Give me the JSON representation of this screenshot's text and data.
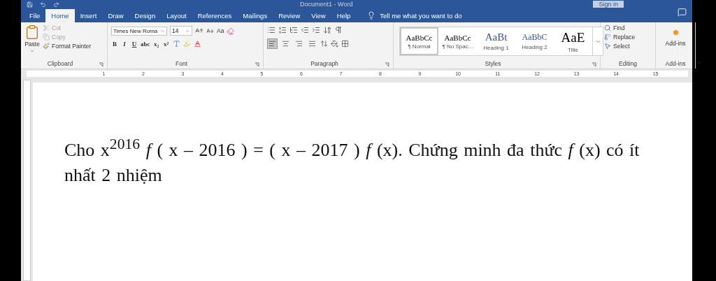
{
  "window": {
    "title": "Document1 - Word",
    "sign_in": "Sign in"
  },
  "tabs": [
    {
      "label": "File",
      "selected": false
    },
    {
      "label": "Home",
      "selected": true
    },
    {
      "label": "Insert",
      "selected": false
    },
    {
      "label": "Draw",
      "selected": false
    },
    {
      "label": "Design",
      "selected": false
    },
    {
      "label": "Layout",
      "selected": false
    },
    {
      "label": "References",
      "selected": false
    },
    {
      "label": "Mailings",
      "selected": false
    },
    {
      "label": "Review",
      "selected": false
    },
    {
      "label": "View",
      "selected": false
    },
    {
      "label": "Help",
      "selected": false
    }
  ],
  "tell_me": "Tell me what you want to do",
  "clipboard": {
    "paste": "Paste",
    "items": [
      {
        "kind": "cut",
        "label": "Cut",
        "disabled": true
      },
      {
        "kind": "copy",
        "label": "Copy",
        "disabled": true
      },
      {
        "kind": "painter",
        "label": "Format Painter",
        "disabled": false
      }
    ],
    "title": "Clipboard"
  },
  "font": {
    "name": "Times New Roma",
    "size": "14",
    "case": "Aa",
    "styles": [
      "B",
      "I",
      "U",
      "abc",
      "x₂",
      "x²"
    ],
    "title": "Font"
  },
  "paragraph": {
    "title": "Paragraph",
    "align": [
      {
        "kind": "left",
        "selected": true
      },
      {
        "kind": "center",
        "selected": false
      },
      {
        "kind": "right",
        "selected": false
      },
      {
        "kind": "justify",
        "selected": false
      }
    ]
  },
  "styles": {
    "title": "Styles",
    "items": [
      {
        "sample": "AaBbCc",
        "label": "¶ Normal",
        "kind": "normal",
        "selected": true
      },
      {
        "sample": "AaBbCc",
        "label": "¶ No Spac...",
        "kind": "normal",
        "selected": false
      },
      {
        "sample": "AaBt",
        "label": "Heading 1",
        "kind": "heading1",
        "selected": false
      },
      {
        "sample": "AaBbC",
        "label": "Heading 2",
        "kind": "heading2",
        "selected": false
      },
      {
        "sample": "AaE",
        "label": "Title",
        "kind": "title",
        "selected": false
      }
    ]
  },
  "editing": {
    "title": "Editing",
    "items": [
      {
        "kind": "find",
        "label": "Find"
      },
      {
        "kind": "replace",
        "label": "Replace"
      },
      {
        "kind": "select",
        "label": "Select"
      }
    ]
  },
  "addins": {
    "button": "Add-ins",
    "title": "Add-ins"
  },
  "ruler": [
    "1",
    "2",
    "3",
    "4",
    "5",
    "6",
    "7",
    "8",
    "9",
    "10",
    "11",
    "12",
    "13",
    "14",
    "15"
  ],
  "document": {
    "paragraph": "Cho x$^{2016}$ *f* ( x – 2016 ) = ( x – 2017 ) *f* (x). Chứng minh đa thức *f* (x) có ít nhất 2 nhiệm"
  }
}
